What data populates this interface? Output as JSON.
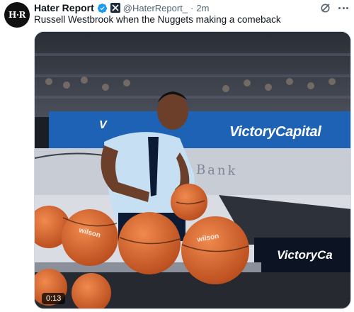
{
  "author": {
    "name": "Hater Report",
    "handle": "@HaterReport_",
    "separator": "·",
    "time": "2m",
    "avatar_text": "H·R"
  },
  "tweet": {
    "text": "Russell Westbrook when the Nuggets making a comeback"
  },
  "media": {
    "timestamp": "0:13",
    "signage_left": "V",
    "signage_main": "VictoryCapital",
    "signage_court_board": "VictoryCa",
    "floor_text": "Bank"
  },
  "colors": {
    "verified": "#1d9bf0",
    "text": "#0f1419",
    "secondary": "#536471",
    "board_blue": "#1e62b5"
  },
  "icons": {
    "verified": "verified-badge-icon",
    "affiliate": "affiliate-badge-icon",
    "grok": "grok-icon",
    "more": "more-options-icon"
  }
}
